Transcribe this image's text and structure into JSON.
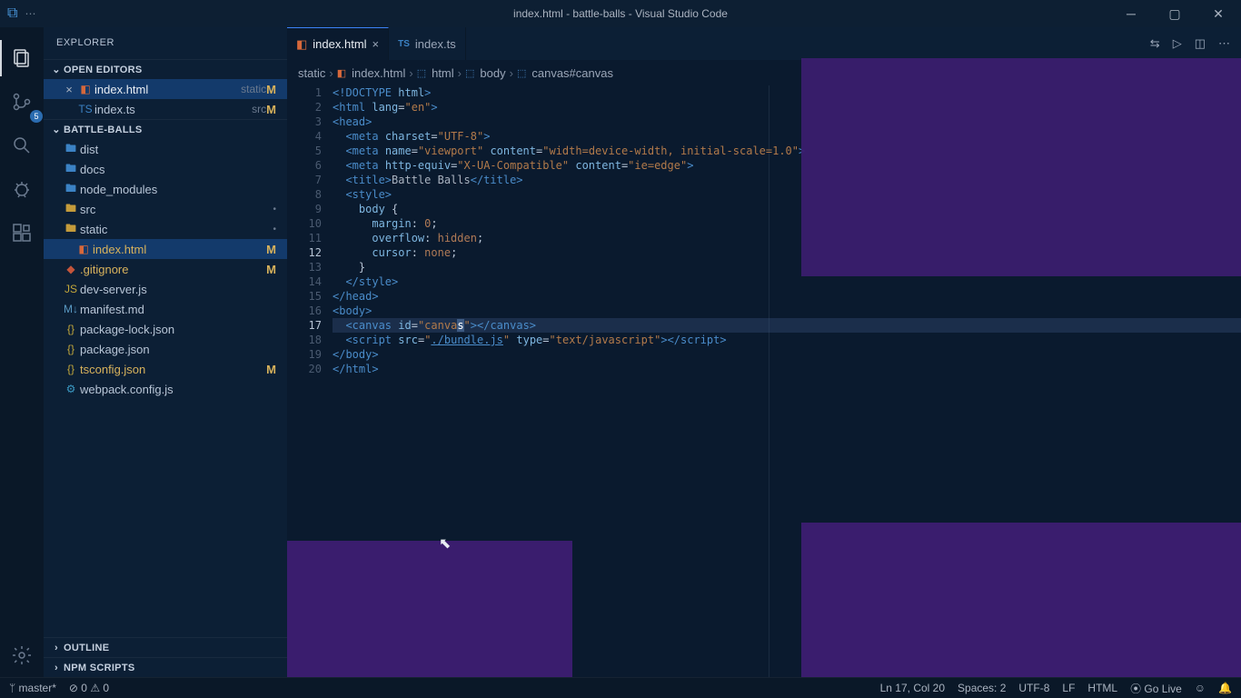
{
  "window": {
    "title": "index.html - battle-balls - Visual Studio Code"
  },
  "sidebar": {
    "title": "EXPLORER",
    "sections": {
      "open_editors": {
        "label": "OPEN EDITORS",
        "items": [
          {
            "name": "index.html",
            "dir": "static",
            "mod": "M"
          },
          {
            "name": "index.ts",
            "dir": "src",
            "mod": "M"
          }
        ]
      },
      "project": {
        "label": "BATTLE-BALLS",
        "tree": [
          {
            "name": "dist",
            "kind": "folder"
          },
          {
            "name": "docs",
            "kind": "folder"
          },
          {
            "name": "node_modules",
            "kind": "folder"
          },
          {
            "name": "src",
            "kind": "folder",
            "dot": "•"
          },
          {
            "name": "static",
            "kind": "folder",
            "dot": "•"
          },
          {
            "name": "index.html",
            "kind": "file",
            "mod": "M",
            "active": true
          },
          {
            "name": ".gitignore",
            "kind": "file",
            "mod": "M"
          },
          {
            "name": "dev-server.js",
            "kind": "file"
          },
          {
            "name": "manifest.md",
            "kind": "file"
          },
          {
            "name": "package-lock.json",
            "kind": "file"
          },
          {
            "name": "package.json",
            "kind": "file"
          },
          {
            "name": "tsconfig.json",
            "kind": "file",
            "mod": "M"
          },
          {
            "name": "webpack.config.js",
            "kind": "file"
          }
        ]
      },
      "outline": {
        "label": "OUTLINE"
      },
      "npm": {
        "label": "NPM SCRIPTS"
      }
    }
  },
  "tabs": [
    {
      "name": "index.html",
      "active": true
    },
    {
      "name": "index.ts",
      "active": false
    }
  ],
  "breadcrumbs": [
    "static",
    "index.html",
    "html",
    "body",
    "canvas#canvas"
  ],
  "code_lines": 20,
  "active_line": 17,
  "statusbar": {
    "branch": "master*",
    "errors": "0",
    "warnings": "0",
    "ln_col": "Ln 17, Col 20",
    "spaces": "Spaces: 2",
    "encoding": "UTF-8",
    "eol": "LF",
    "lang": "HTML",
    "golive": "Go Live",
    "feedback": "☺"
  },
  "scm_count": "5"
}
